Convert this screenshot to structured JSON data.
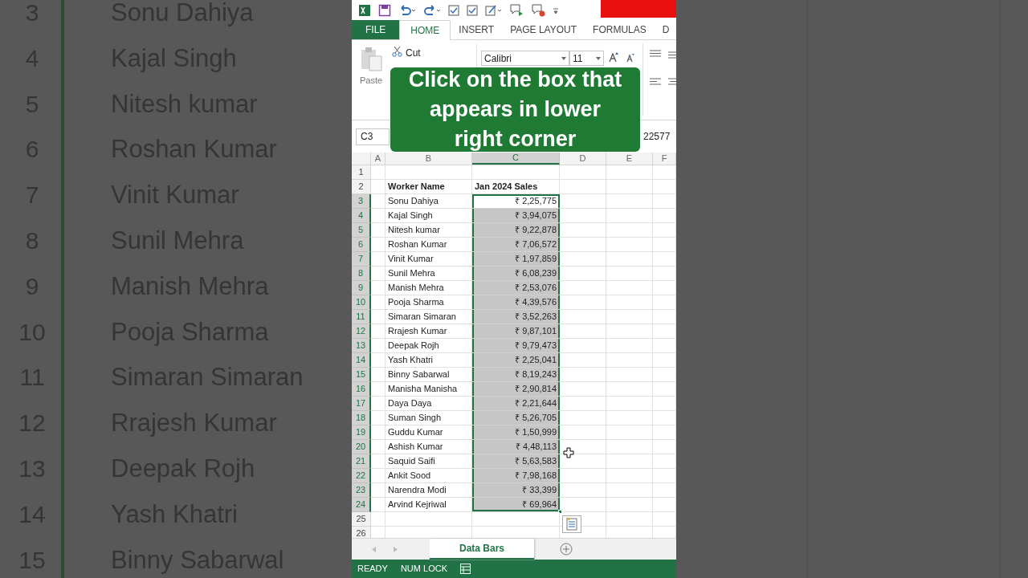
{
  "backdrop": {
    "rows": [
      {
        "number": "3",
        "name": "Sonu Dahiya"
      },
      {
        "number": "4",
        "name": "Kajal Singh"
      },
      {
        "number": "5",
        "name": "Nitesh kumar"
      },
      {
        "number": "6",
        "name": "Roshan Kumar"
      },
      {
        "number": "7",
        "name": "Vinit Kumar"
      },
      {
        "number": "8",
        "name": "Sunil Mehra"
      },
      {
        "number": "9",
        "name": "Manish Mehra"
      },
      {
        "number": "10",
        "name": "Pooja Sharma"
      },
      {
        "number": "11",
        "name": "Simaran Simaran"
      },
      {
        "number": "12",
        "name": "Rrajesh Kumar"
      },
      {
        "number": "13",
        "name": "Deepak Rojh"
      },
      {
        "number": "14",
        "name": "Yash Khatri"
      },
      {
        "number": "15",
        "name": "Binny Sabarwal"
      }
    ]
  },
  "ribbon_tabs": [
    {
      "label": "FILE",
      "kind": "file",
      "selected": false
    },
    {
      "label": "HOME",
      "kind": "tab",
      "selected": true
    },
    {
      "label": "INSERT",
      "kind": "tab",
      "selected": false
    },
    {
      "label": "PAGE LAYOUT",
      "kind": "tab",
      "selected": false
    },
    {
      "label": "FORMULAS",
      "kind": "tab",
      "selected": false
    },
    {
      "label": "D",
      "kind": "tab",
      "selected": false
    }
  ],
  "clipboard": {
    "paste": "Paste",
    "cut": "Cut"
  },
  "font": {
    "name": "Calibri",
    "size": "11"
  },
  "formula_bar": {
    "name_box": "C3",
    "value": "22577"
  },
  "caption": {
    "lines": [
      "Click on the box that",
      "appears in lower",
      "right corner"
    ]
  },
  "columns": [
    {
      "label": "A",
      "selected": false
    },
    {
      "label": "B",
      "selected": false
    },
    {
      "label": "C",
      "selected": true
    },
    {
      "label": "D",
      "selected": false
    },
    {
      "label": "E",
      "selected": false
    },
    {
      "label": "F",
      "selected": false
    }
  ],
  "rows": [
    {
      "number": "1",
      "kind": "empty",
      "selected": false
    },
    {
      "number": "2",
      "kind": "header",
      "selected": false,
      "name": "Worker Name",
      "sales": "Jan 2024 Sales"
    },
    {
      "number": "3",
      "kind": "data",
      "selected": true,
      "active": true,
      "name": "Sonu Dahiya",
      "sales": "₹ 2,25,775"
    },
    {
      "number": "4",
      "kind": "data",
      "selected": true,
      "active": false,
      "name": "Kajal Singh",
      "sales": "₹ 3,94,075"
    },
    {
      "number": "5",
      "kind": "data",
      "selected": true,
      "active": false,
      "name": "Nitesh kumar",
      "sales": "₹ 9,22,878"
    },
    {
      "number": "6",
      "kind": "data",
      "selected": true,
      "active": false,
      "name": "Roshan Kumar",
      "sales": "₹ 7,06,572"
    },
    {
      "number": "7",
      "kind": "data",
      "selected": true,
      "active": false,
      "name": "Vinit Kumar",
      "sales": "₹ 1,97,859"
    },
    {
      "number": "8",
      "kind": "data",
      "selected": true,
      "active": false,
      "name": "Sunil Mehra",
      "sales": "₹ 6,08,239"
    },
    {
      "number": "9",
      "kind": "data",
      "selected": true,
      "active": false,
      "name": "Manish Mehra",
      "sales": "₹ 2,53,076"
    },
    {
      "number": "10",
      "kind": "data",
      "selected": true,
      "active": false,
      "name": "Pooja Sharma",
      "sales": "₹ 4,39,576"
    },
    {
      "number": "11",
      "kind": "data",
      "selected": true,
      "active": false,
      "name": "Simaran Simaran",
      "sales": "₹ 3,52,263"
    },
    {
      "number": "12",
      "kind": "data",
      "selected": true,
      "active": false,
      "name": "Rrajesh Kumar",
      "sales": "₹ 9,87,101"
    },
    {
      "number": "13",
      "kind": "data",
      "selected": true,
      "active": false,
      "name": "Deepak Rojh",
      "sales": "₹ 9,79,473"
    },
    {
      "number": "14",
      "kind": "data",
      "selected": true,
      "active": false,
      "name": "Yash Khatri",
      "sales": "₹ 2,25,041"
    },
    {
      "number": "15",
      "kind": "data",
      "selected": true,
      "active": false,
      "name": "Binny Sabarwal",
      "sales": "₹ 8,19,243"
    },
    {
      "number": "16",
      "kind": "data",
      "selected": true,
      "active": false,
      "name": "Manisha Manisha",
      "sales": "₹ 2,90,814"
    },
    {
      "number": "17",
      "kind": "data",
      "selected": true,
      "active": false,
      "name": "Daya Daya",
      "sales": "₹ 2,21,644"
    },
    {
      "number": "18",
      "kind": "data",
      "selected": true,
      "active": false,
      "name": "Suman Singh",
      "sales": "₹ 5,26,705"
    },
    {
      "number": "19",
      "kind": "data",
      "selected": true,
      "active": false,
      "name": "Guddu Kumar",
      "sales": "₹ 1,50,999"
    },
    {
      "number": "20",
      "kind": "data",
      "selected": true,
      "active": false,
      "name": "Ashish Kumar",
      "sales": "₹ 4,48,113"
    },
    {
      "number": "21",
      "kind": "data",
      "selected": true,
      "active": false,
      "name": "Saquid Saifi",
      "sales": "₹ 5,63,583"
    },
    {
      "number": "22",
      "kind": "data",
      "selected": true,
      "active": false,
      "name": "Ankit Sood",
      "sales": "₹ 7,98,168"
    },
    {
      "number": "23",
      "kind": "data",
      "selected": true,
      "active": false,
      "name": "Narendra Modi",
      "sales": "₹ 33,399"
    },
    {
      "number": "24",
      "kind": "data",
      "selected": true,
      "active": false,
      "name": "Arvind Kejriwal",
      "sales": "₹ 69,964"
    },
    {
      "number": "25",
      "kind": "empty",
      "selected": false
    },
    {
      "number": "26",
      "kind": "empty",
      "selected": false
    }
  ],
  "sheet_tabs": [
    {
      "label": "Data Bars",
      "selected": true
    }
  ],
  "status_bar": {
    "items": [
      "READY",
      "NUM LOCK"
    ]
  }
}
